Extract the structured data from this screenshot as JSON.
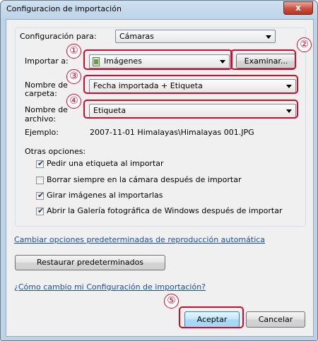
{
  "window": {
    "title": "Configuracion de importación",
    "close": "x"
  },
  "config": {
    "label": "Configuración para:",
    "value": "Cámaras"
  },
  "importar": {
    "label": "Importar a:",
    "value": "Imágenes",
    "browse": "Examinar..."
  },
  "carpeta": {
    "label_line1": "Nombre de",
    "label_line2": "carpeta:",
    "value": "Fecha importada + Etiqueta"
  },
  "archivo": {
    "label_line1": "Nombre de",
    "label_line2": "archivo:",
    "value": "Etiqueta"
  },
  "ejemplo": {
    "label": "Ejemplo:",
    "value": "2007-11-01 Himalayas\\Himalayas 001.JPG"
  },
  "otras": {
    "label": "Otras opciones:",
    "items": [
      {
        "label": "Pedir una etiqueta al importar",
        "checked": true
      },
      {
        "label": "Borrar siempre en la cámara después de importar",
        "checked": false
      },
      {
        "label": "Girar imágenes al importarlas",
        "checked": true
      },
      {
        "label": "Abrir la Galería fotográfica de Windows después de importar",
        "checked": true
      }
    ]
  },
  "links": {
    "autoplay": "Cambiar opciones predeterminadas de reproducción automática",
    "help": "¿Cómo cambio mi Configuración de importación?"
  },
  "buttons": {
    "restore": "Restaurar predeterminados",
    "accept": "Aceptar",
    "cancel": "Cancelar"
  },
  "callouts": [
    "①",
    "②",
    "③",
    "④",
    "⑤"
  ],
  "colors": {
    "callout": "#d40a2c",
    "link": "#1a4fa0"
  }
}
